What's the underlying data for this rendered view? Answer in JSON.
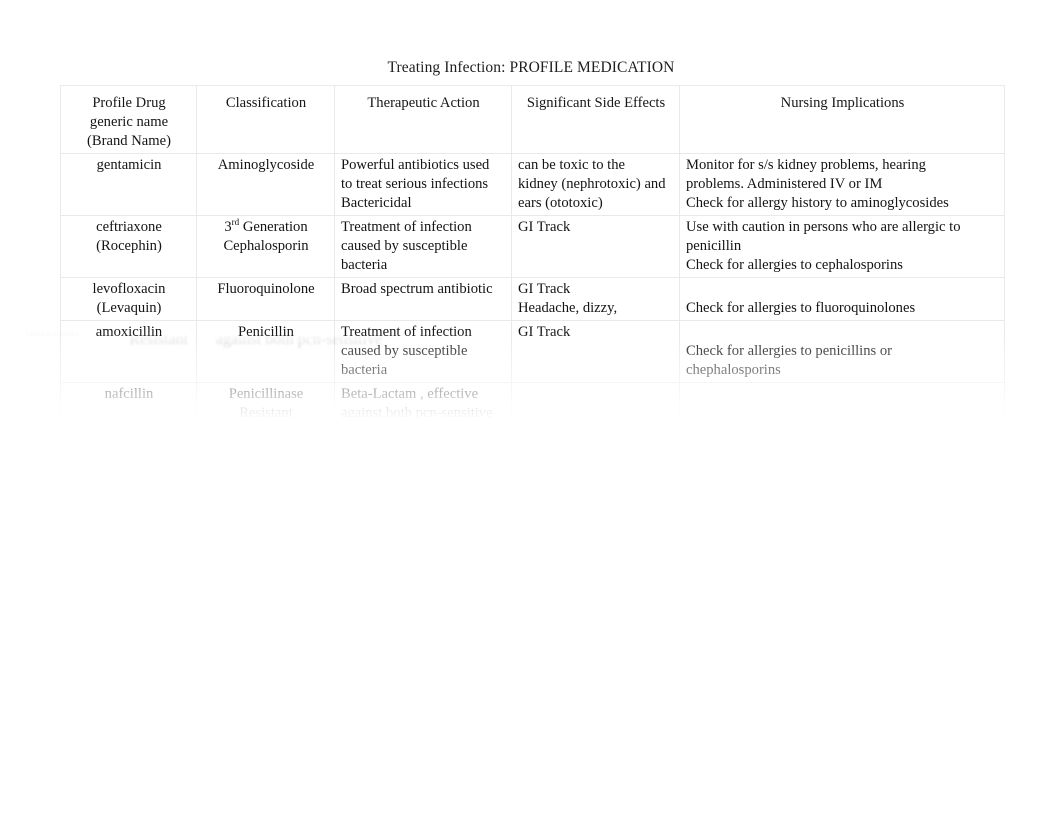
{
  "document": {
    "title": "Treating Infection: PROFILE MEDICATION"
  },
  "table": {
    "headers": [
      "Profile Drug\ngeneric name\n(Brand Name)",
      "Classification",
      "Therapeutic Action",
      "Significant Side Effects",
      "Nursing Implications"
    ],
    "header_cells": {
      "drug": {
        "line1": "Profile Drug",
        "line2": "generic name",
        "line3": "(Brand Name)"
      },
      "classification": "Classification",
      "therapeutic_action": "Therapeutic Action",
      "side_effects": "Significant Side Effects",
      "nursing_implications": "Nursing Implications"
    },
    "rows": [
      {
        "drug_lines": [
          "gentamicin"
        ],
        "classification_lines": [
          "Aminoglycoside"
        ],
        "therapeutic_action_lines": [
          "Powerful antibiotics used",
          "to treat serious infections",
          "Bactericidal"
        ],
        "side_effects_lines": [
          "can be toxic to the",
          "kidney (nephrotoxic) and",
          "ears (ototoxic)"
        ],
        "nursing_implications_lines": [
          "Monitor for s/s kidney problems, hearing",
          "problems. Administered IV or IM",
          "Check for allergy history to aminoglycosides"
        ],
        "legible": true
      },
      {
        "drug_lines": [
          "ceftriaxone",
          "(Rocephin)"
        ],
        "classification_pre": "3",
        "classification_sup": "rd",
        "classification_post": " Generation",
        "classification_lines": [
          "Cephalosporin"
        ],
        "therapeutic_action_lines": [
          "Treatment of infection",
          "caused by susceptible",
          "bacteria"
        ],
        "side_effects_lines": [
          "GI Track"
        ],
        "nursing_implications_lines": [
          "Use with caution in persons who are allergic to",
          "penicillin",
          "Check for allergies to cephalosporins"
        ],
        "legible": true
      },
      {
        "drug_lines": [
          "levofloxacin",
          "(Levaquin)"
        ],
        "classification_lines": [
          "Fluoroquinolone"
        ],
        "therapeutic_action_lines": [
          "Broad spectrum antibiotic"
        ],
        "side_effects_lines": [
          "GI Track",
          "Headache, dizzy,"
        ],
        "nursing_implications_lines": [
          "",
          "Check for allergies to fluoroquinolones"
        ],
        "legible": true
      },
      {
        "drug_lines": [
          "amoxicillin"
        ],
        "classification_lines": [
          "Penicillin"
        ],
        "therapeutic_action_lines": [
          "Treatment of infection",
          "caused by susceptible",
          "bacteria"
        ],
        "side_effects_lines": [
          "GI Track"
        ],
        "nursing_implications_lines": [
          "",
          "Check for allergies to penicillins or",
          "chephalosporins"
        ],
        "legible": true
      },
      {
        "drug_lines": [
          "nafcillin"
        ],
        "classification_lines": [
          "Penicillinase",
          "Resistant"
        ],
        "therapeutic_action_lines": [
          "Beta-Lactam , effective",
          "against both pcn-sensitive"
        ],
        "side_effects_lines": [
          "",
          "",
          ""
        ],
        "nursing_implications_lines": [
          "",
          ""
        ],
        "legible": true
      },
      {
        "drug_lines": [
          ""
        ],
        "classification_lines": [
          ""
        ],
        "therapeutic_action_lines": [
          "",
          "",
          ""
        ],
        "side_effects_lines": [
          "",
          "",
          ""
        ],
        "nursing_implications_lines": [
          "",
          ""
        ],
        "legible": false
      },
      {
        "drug_lines": [
          ""
        ],
        "classification_lines": [
          ""
        ],
        "therapeutic_action_lines": [
          "",
          "",
          "",
          ""
        ],
        "side_effects_lines": [
          "",
          "",
          "",
          ""
        ],
        "nursing_implications_lines": [
          "",
          "",
          ""
        ],
        "legible": false
      },
      {
        "drug_lines": [
          ""
        ],
        "classification_lines": [
          ""
        ],
        "therapeutic_action_lines": [
          "",
          ""
        ],
        "side_effects_lines": [
          "",
          ""
        ],
        "nursing_implications_lines": [
          ""
        ],
        "legible": false
      },
      {
        "drug_lines": [
          "",
          ""
        ],
        "classification_lines": [
          ""
        ],
        "therapeutic_action_lines": [
          "",
          "",
          ""
        ],
        "side_effects_lines": [
          "",
          ""
        ],
        "nursing_implications_lines": [
          "",
          ""
        ],
        "legible": false
      },
      {
        "drug_lines": [
          "",
          "",
          ""
        ],
        "classification_lines": [
          ""
        ],
        "therapeutic_action_lines": [
          "",
          "",
          ""
        ],
        "side_effects_lines": [
          "",
          "",
          ""
        ],
        "nursing_implications_lines": [
          "",
          "",
          ""
        ],
        "legible": false
      }
    ]
  },
  "bottom_note": {
    "lines": [
      "",
      "",
      ""
    ],
    "legible": false
  }
}
